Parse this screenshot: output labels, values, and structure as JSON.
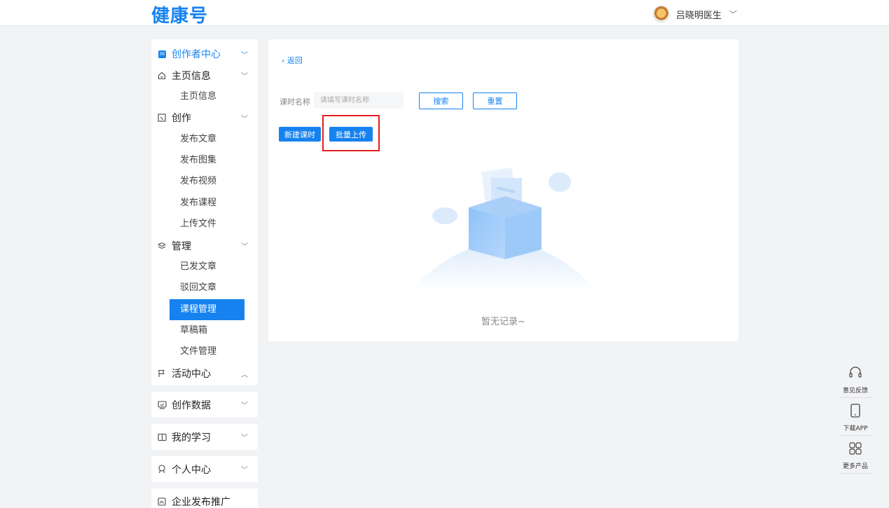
{
  "header": {
    "logo": "健康号",
    "user_name": "吕晓明医生"
  },
  "sidebar": {
    "creator_center": "创作者中心",
    "homepage_info": "主页信息",
    "homepage_info_sub": "主页信息",
    "create": "创作",
    "create_items": [
      "发布文章",
      "发布图集",
      "发布视频",
      "发布课程",
      "上传文件"
    ],
    "manage": "管理",
    "manage_items": [
      "已发文章",
      "驳回文章",
      "课程管理",
      "草稿箱",
      "文件管理"
    ],
    "activity_center": "活动中心",
    "creation_data": "创作数据",
    "my_learning": "我的学习",
    "personal_center": "个人中心",
    "enterprise_promo": "企业发布推广"
  },
  "content": {
    "back": "返回",
    "search_label": "课时名称",
    "search_placeholder": "请填写课时名称",
    "search_button": "搜索",
    "reset_button": "重置",
    "new_lesson_button": "新建课时",
    "batch_upload_button": "批量上传",
    "empty_text": "暂无记录~"
  },
  "float_bar": {
    "feedback": "意见反馈",
    "download_app": "下载APP",
    "more_products": "更多产品"
  },
  "colors": {
    "accent": "#1682f0",
    "highlight": "#e61e1e"
  }
}
